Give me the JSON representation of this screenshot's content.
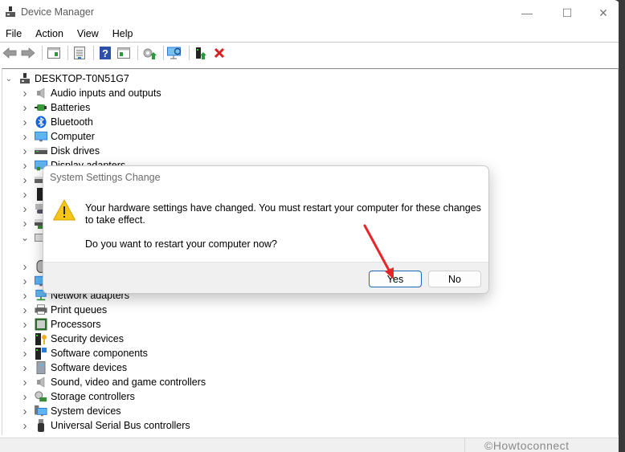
{
  "window": {
    "title": "Device Manager",
    "controls": {
      "minimize": "—",
      "maximize": "☐",
      "close": "✕"
    }
  },
  "menu": [
    "File",
    "Action",
    "View",
    "Help"
  ],
  "toolbar": [
    {
      "icon": "back-arrow-icon"
    },
    {
      "icon": "forward-arrow-icon"
    },
    {
      "icon": "show-hide-console-tree-icon"
    },
    {
      "icon": "properties-icon"
    },
    {
      "icon": "help-icon"
    },
    {
      "icon": "show-action-pane-icon"
    },
    {
      "icon": "update-driver-icon"
    },
    {
      "icon": "scan-hardware-changes-icon"
    },
    {
      "icon": "enable-device-icon"
    },
    {
      "icon": "uninstall-device-icon"
    }
  ],
  "tree": {
    "root": "DESKTOP-T0N51G7",
    "items": [
      {
        "label": "Audio inputs and outputs",
        "expanded": false,
        "icon": "speaker-icon"
      },
      {
        "label": "Batteries",
        "expanded": false,
        "icon": "battery-icon"
      },
      {
        "label": "Bluetooth",
        "expanded": false,
        "icon": "bluetooth-icon"
      },
      {
        "label": "Computer",
        "expanded": false,
        "icon": "monitor-icon"
      },
      {
        "label": "Disk drives",
        "expanded": false,
        "icon": "disk-drive-icon"
      },
      {
        "label": "Display adapters",
        "expanded": false,
        "icon": "display-adapter-icon"
      },
      {
        "label": "",
        "expanded": false,
        "icon": "dvd-drive-icon"
      },
      {
        "label": "",
        "expanded": false,
        "icon": "firmware-icon"
      },
      {
        "label": "",
        "expanded": false,
        "icon": "hid-icon"
      },
      {
        "label": "",
        "expanded": false,
        "icon": "ide-controller-icon"
      },
      {
        "label": "",
        "expanded": true,
        "icon": "keyboard-icon"
      },
      {
        "label": "",
        "expanded": false,
        "icon": "mouse-icon"
      },
      {
        "label": "",
        "expanded": false,
        "icon": "monitor-icon"
      },
      {
        "label": "Network adapters",
        "expanded": false,
        "icon": "network-icon"
      },
      {
        "label": "Print queues",
        "expanded": false,
        "icon": "printer-icon"
      },
      {
        "label": "Processors",
        "expanded": false,
        "icon": "processor-icon"
      },
      {
        "label": "Security devices",
        "expanded": false,
        "icon": "security-key-icon"
      },
      {
        "label": "Software components",
        "expanded": false,
        "icon": "software-component-icon"
      },
      {
        "label": "Software devices",
        "expanded": false,
        "icon": "software-device-icon"
      },
      {
        "label": "Sound, video and game controllers",
        "expanded": false,
        "icon": "speaker-icon"
      },
      {
        "label": "Storage controllers",
        "expanded": false,
        "icon": "storage-controller-icon"
      },
      {
        "label": "System devices",
        "expanded": false,
        "icon": "system-devices-icon"
      },
      {
        "label": "Universal Serial Bus controllers",
        "expanded": false,
        "icon": "usb-icon"
      }
    ]
  },
  "dialog": {
    "title": "System Settings Change",
    "message": "Your hardware settings have changed. You must restart your computer for these changes to take effect.",
    "question": "Do you want to restart your computer now?",
    "yes_label": "Yes",
    "no_label": "No"
  },
  "watermark": "©Howtoconnect",
  "colors": {
    "accent": "#1a66b8",
    "annotation_arrow": "#e8262a",
    "warning": "#f5c518"
  }
}
